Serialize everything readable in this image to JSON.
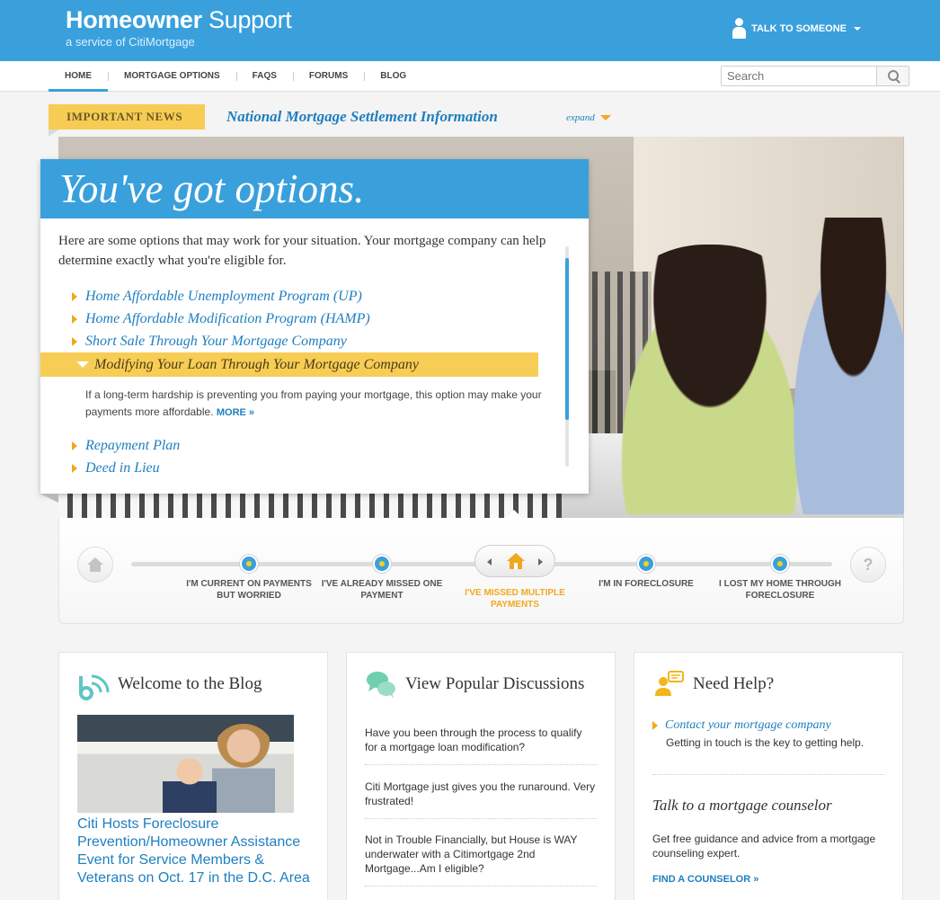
{
  "header": {
    "brand_strong": "Homeowner",
    "brand_rest": " Support",
    "brand_sub": "a service of CitiMortgage",
    "talk_label": "TALK TO SOMEONE",
    "accent": "#3aa0dc"
  },
  "nav": {
    "items": [
      {
        "label": "HOME",
        "active": true
      },
      {
        "label": "MORTGAGE OPTIONS"
      },
      {
        "label": "FAQS"
      },
      {
        "label": "FORUMS"
      },
      {
        "label": "BLOG"
      }
    ],
    "search_placeholder": "Search"
  },
  "news": {
    "tag": "IMPORTANT NEWS",
    "title": "National Mortgage Settlement Information",
    "expand": "expand",
    "tag_color": "#f6cc55"
  },
  "options": {
    "heading": "You've got options.",
    "intro": "Here are some options that may work for your situation. Your mortgage company can help determine exactly what you're eligible for.",
    "items": [
      {
        "label": "Home Affordable Unemployment Program (UP)"
      },
      {
        "label": "Home Affordable Modification Program (HAMP)"
      },
      {
        "label": "Short Sale Through Your Mortgage Company"
      },
      {
        "label": "Modifying Your Loan Through Your Mortgage Company",
        "expanded": true,
        "description": "If a long-term hardship is preventing you from paying your mortgage, this option may make your payments more affordable.",
        "more": "MORE »"
      },
      {
        "label": "Repayment Plan"
      },
      {
        "label": "Deed in Lieu"
      }
    ]
  },
  "timeline": {
    "start_icon": "home-icon",
    "end_icon": "question-icon",
    "end_glyph": "?",
    "steps": [
      {
        "label": "I'M CURRENT ON PAYMENTS BUT WORRIED"
      },
      {
        "label": "I'VE ALREADY MISSED ONE PAYMENT"
      },
      {
        "label": "I'VE MISSED MULTIPLE PAYMENTS",
        "current": true
      },
      {
        "label": "I'M IN FORECLOSURE"
      },
      {
        "label": "I LOST MY HOME THROUGH FORECLOSURE"
      }
    ]
  },
  "blog": {
    "title": "Welcome to the Blog",
    "link": "Citi Hosts Foreclosure Prevention/Homeowner Assistance Event for Service Members & Veterans on Oct. 17 in the D.C. Area"
  },
  "discussions": {
    "title": "View Popular Discussions",
    "items": [
      "Have you been through the process to qualify for a mortgage loan modification?",
      "Citi Mortgage just gives you the runaround. Very frustrated!",
      "Not in Trouble Financially, but House is WAY underwater with a Citimortgage 2nd Mortgage...Am I eligible?"
    ]
  },
  "help": {
    "title": "Need Help?",
    "link": "Contact your mortgage company",
    "link_sub": "Getting in touch is the key to getting help.",
    "counselor_title": "Talk to a mortgage counselor",
    "counselor_text": "Get free guidance and advice from a mortgage counseling expert.",
    "cta": "FIND A COUNSELOR »"
  }
}
